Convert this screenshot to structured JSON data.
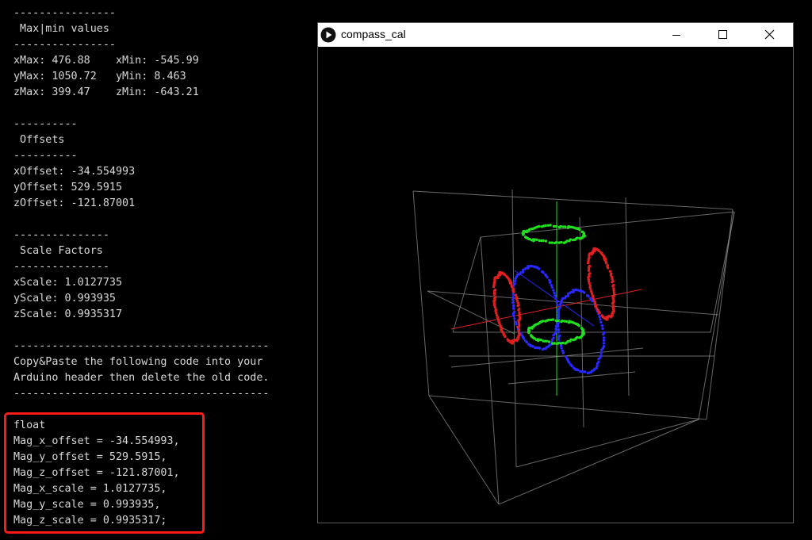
{
  "console": {
    "lines": [
      "----------------",
      " Max|min values",
      "----------------",
      "xMax: 476.88    xMin: -545.99",
      "yMax: 1050.72   yMin: 8.463",
      "zMax: 399.47    zMin: -643.21",
      "",
      "----------",
      " Offsets",
      "----------",
      "xOffset: -34.554993",
      "yOffset: 529.5915",
      "zOffset: -121.87001",
      "",
      "---------------",
      " Scale Factors",
      "---------------",
      "xScale: 1.0127735",
      "yScale: 0.993935",
      "zScale: 0.9935317",
      "",
      "----------------------------------------",
      "Copy&Paste the following code into your",
      "Arduino header then delete the old code.",
      "----------------------------------------",
      "float",
      "Mag_x_offset = -34.554993,",
      "Mag_y_offset = 529.5915,",
      "Mag_z_offset = -121.87001,",
      "Mag_x_scale = 1.0127735,",
      "Mag_y_scale = 0.993935,",
      "Mag_z_scale = 0.9935317;"
    ]
  },
  "window": {
    "title": "compass_cal",
    "icons": {
      "app": "processing-play-icon",
      "minimize": "minimize-icon",
      "maximize": "maximize-icon",
      "close": "close-icon"
    }
  },
  "colors": {
    "x_axis": "#e02020",
    "y_axis": "#20e020",
    "z_axis": "#2828ff",
    "grid": "#8a8a8a",
    "highlight": "#ff1a1a"
  }
}
